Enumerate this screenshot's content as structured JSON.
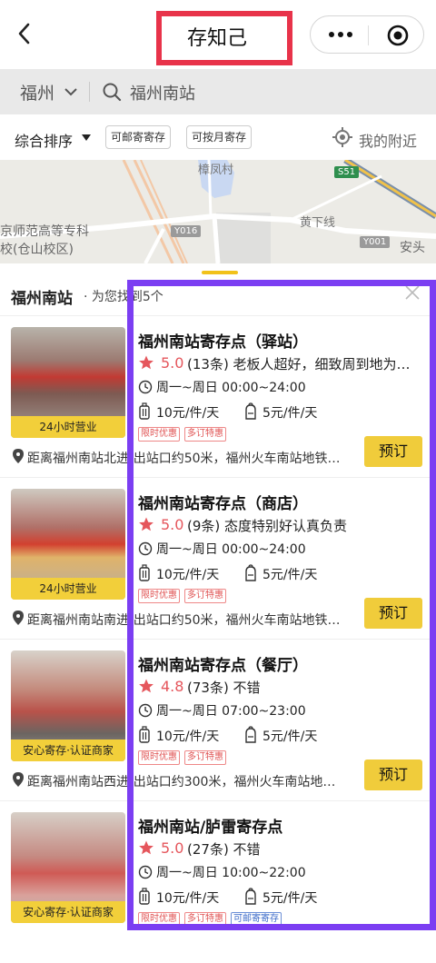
{
  "header": {
    "title": "存知己"
  },
  "search": {
    "city": "福州",
    "query": "福州南站"
  },
  "filters": {
    "sort": "综合排序",
    "chips": [
      "可邮寄寄存",
      "可按月寄存"
    ],
    "nearby": "我的附近"
  },
  "map": {
    "labels": {
      "village": "樟凤村",
      "road": "黄下线",
      "town": "安头",
      "school_line1": "京师范高等专科",
      "school_line2": "校(仓山校区)"
    },
    "shields": [
      "S51",
      "Y016",
      "Y001"
    ]
  },
  "list": {
    "title": "福州南站",
    "subtitle": "· 为您找到5个",
    "items": [
      {
        "name": "福州南站寄存点（驿站）",
        "score": "5.0",
        "reviews": "(13条) 老板人超好，细致周到地为…",
        "hours": "周一~周日 00:00~24:00",
        "price_luggage": "10元/件/天",
        "price_bag": "5元/件/天",
        "promos": [
          "限时优惠",
          "多订特惠"
        ],
        "tag": "24小时营业",
        "distance": "距离福州南站北进/出站口约50米，福州火车南站地铁…",
        "book": "预订"
      },
      {
        "name": "福州南站寄存点（商店）",
        "score": "5.0",
        "reviews": "(9条) 态度特别好认真负责",
        "hours": "周一~周日 00:00~24:00",
        "price_luggage": "10元/件/天",
        "price_bag": "5元/件/天",
        "promos": [
          "限时优惠",
          "多订特惠"
        ],
        "tag": "24小时营业",
        "distance": "距离福州南站南进/出站口约50米，福州火车南站地铁…",
        "book": "预订"
      },
      {
        "name": "福州南站寄存点（餐厅）",
        "score": "4.8",
        "reviews": "(73条) 不错",
        "hours": "周一~周日 07:00~23:00",
        "price_luggage": "10元/件/天",
        "price_bag": "5元/件/天",
        "promos": [
          "限时优惠",
          "多订特惠"
        ],
        "tag": "安心寄存·认证商家",
        "distance": "距离福州南站西进/出站口约300米，福州火车南站地…",
        "book": "预订"
      },
      {
        "name": "福州南站/胪雷寄存点",
        "score": "5.0",
        "reviews": "(27条) 不错",
        "hours": "周一~周日 10:00~22:00",
        "price_luggage": "10元/件/天",
        "price_bag": "5元/件/天",
        "promos": [
          "限时优惠",
          "多订特惠",
          "可邮寄寄存"
        ],
        "tag": "安心寄存·认证商家",
        "distance": "",
        "book": ""
      }
    ]
  },
  "colors": {
    "accent": "#f2cf3a",
    "rating": "#e5565c",
    "highlight_box": "#7b3ef2",
    "title_box": "#e8334a"
  }
}
